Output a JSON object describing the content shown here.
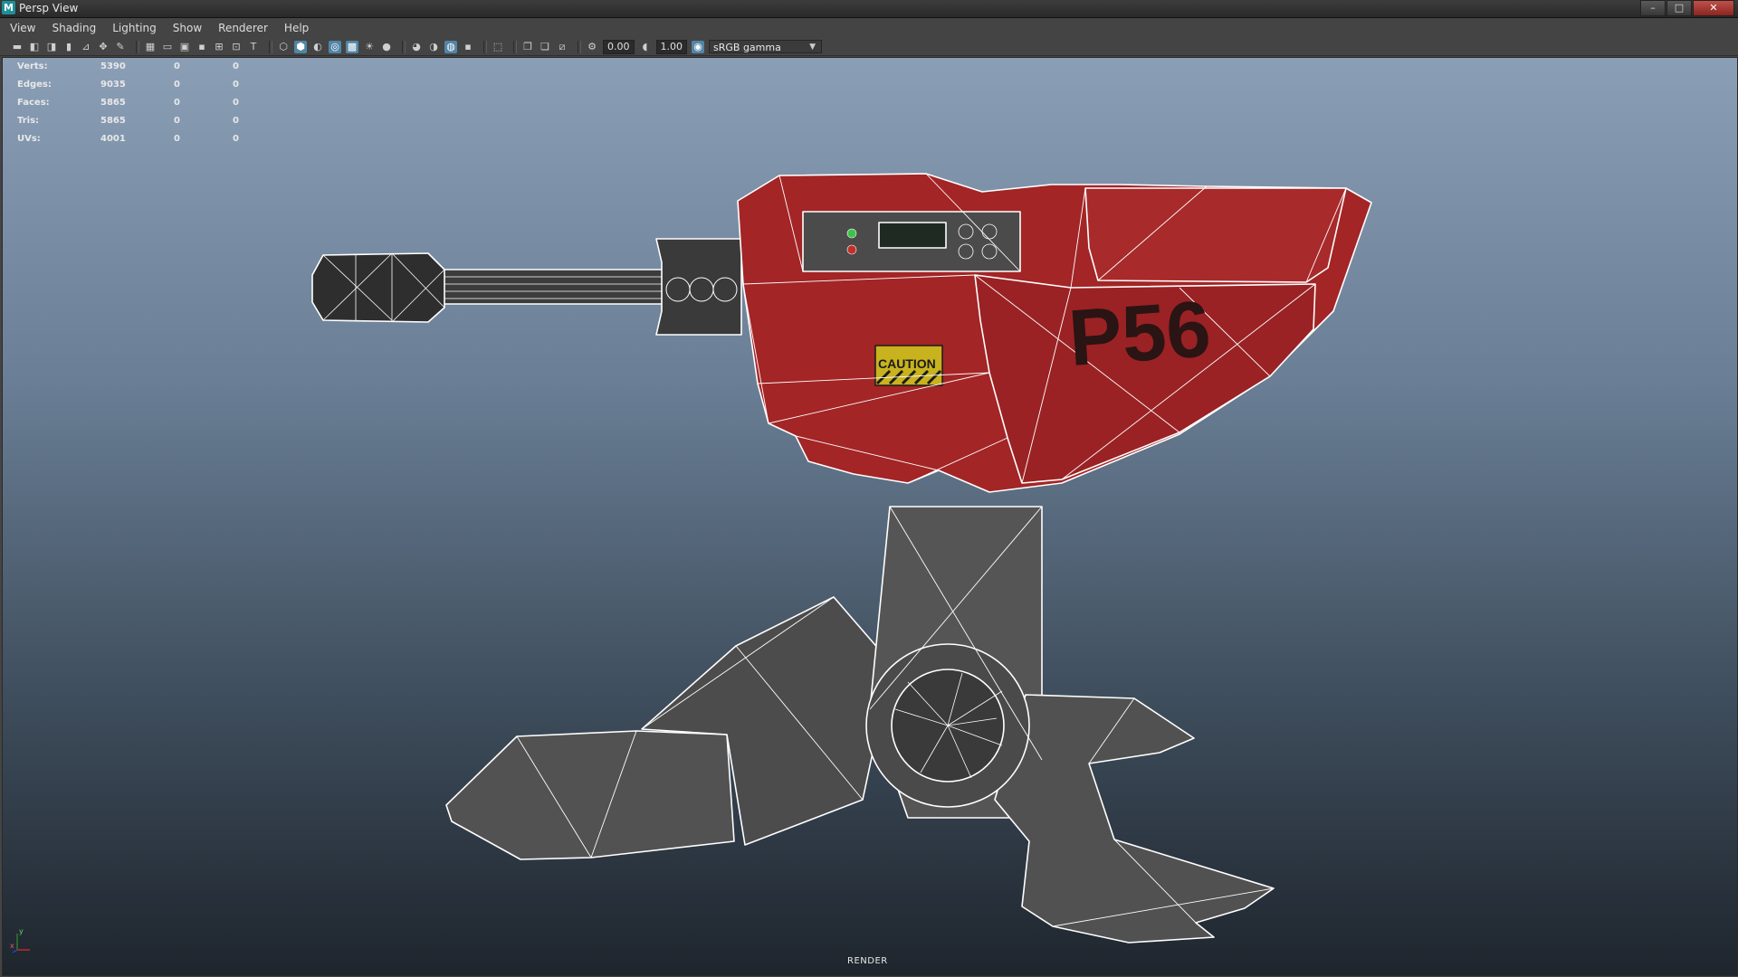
{
  "window": {
    "title": "Persp View",
    "app_icon": "M",
    "buttons": [
      "–",
      "□",
      "✕"
    ]
  },
  "menu": [
    "View",
    "Shading",
    "Lighting",
    "Show",
    "Renderer",
    "Help"
  ],
  "toolbar": {
    "exposure": "0.00",
    "gamma": "1.00",
    "color_space": "sRGB gamma",
    "accent_color": "#5285a6"
  },
  "hud": {
    "rows": [
      {
        "label": "Verts:",
        "v1": "5390",
        "v2": "0",
        "v3": "0"
      },
      {
        "label": "Edges:",
        "v1": "9035",
        "v2": "0",
        "v3": "0"
      },
      {
        "label": "Faces:",
        "v1": "5865",
        "v2": "0",
        "v3": "0"
      },
      {
        "label": "Tris:",
        "v1": "5865",
        "v2": "0",
        "v3": "0"
      },
      {
        "label": "UVs:",
        "v1": "4001",
        "v2": "0",
        "v3": "0"
      }
    ]
  },
  "model": {
    "decal_text": "P56",
    "caution_text": "CAUTION",
    "body_color": "#a8282a",
    "metal_color": "#5a5a5a"
  },
  "axis": {
    "y": "y",
    "x": "x"
  },
  "viewport_label": "RENDER"
}
